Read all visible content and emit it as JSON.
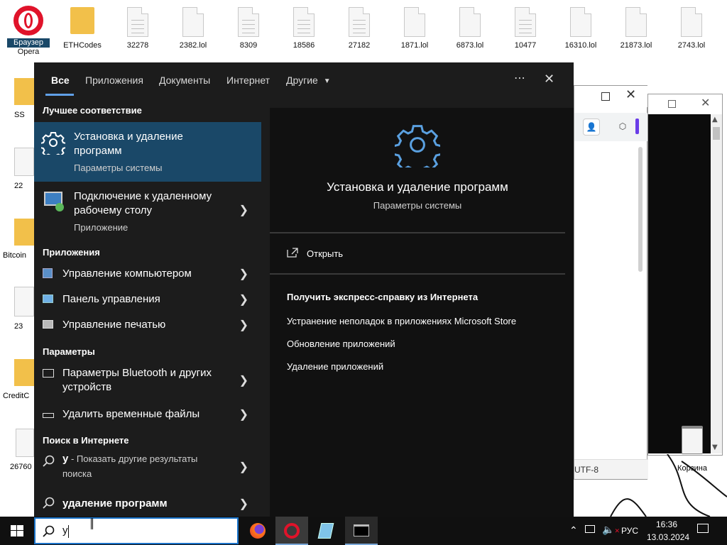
{
  "desktop": {
    "top_icons": [
      {
        "label": "Браузер",
        "label2": "Opera",
        "type": "opera"
      },
      {
        "label": "ETHCodes",
        "type": "folder"
      },
      {
        "label": "32278",
        "type": "lines"
      },
      {
        "label": "2382.lol",
        "type": "file"
      },
      {
        "label": "8309",
        "type": "lines"
      },
      {
        "label": "18586",
        "type": "lines"
      },
      {
        "label": "27182",
        "type": "lines"
      },
      {
        "label": "1871.lol",
        "type": "file"
      },
      {
        "label": "6873.lol",
        "type": "file"
      },
      {
        "label": "10477",
        "type": "lines"
      },
      {
        "label": "16310.lol",
        "type": "file"
      },
      {
        "label": "21873.lol",
        "type": "file"
      },
      {
        "label": "2743.lol",
        "type": "file"
      }
    ],
    "left_icons": [
      "SS",
      "22",
      "Bitcoin",
      "23",
      "CreditC",
      "26760"
    ],
    "right_icons": {
      "recycle": "Корзина"
    },
    "bgwindow": {
      "encoding": "UTF-8"
    }
  },
  "start_menu": {
    "tabs": [
      "Все",
      "Приложения",
      "Документы",
      "Интернет",
      "Другие"
    ],
    "more_icon": "ellipsis-icon",
    "close_icon": "close-icon",
    "sections": {
      "best_match": "Лучшее соответствие",
      "apps": "Приложения",
      "settings": "Параметры",
      "web": "Поиск в Интернете"
    },
    "best_match": {
      "title_line1": "Установка и удаление",
      "title_line2": "программ",
      "subtitle": "Параметры системы"
    },
    "remote_desktop": {
      "title_line1": "Подключение к удаленному",
      "title_line2": "рабочему столу",
      "subtitle": "Приложение"
    },
    "apps": [
      {
        "label": "Управление компьютером",
        "icon": "computer-management-icon"
      },
      {
        "label": "Панель управления",
        "icon": "control-panel-icon"
      },
      {
        "label": "Управление печатью",
        "icon": "print-management-icon"
      }
    ],
    "settings": [
      {
        "label1": "Параметры Bluetooth и других",
        "label2": "устройств",
        "icon": "bluetooth-devices-icon"
      },
      {
        "label1": "Удалить временные файлы",
        "label2": "",
        "icon": "storage-icon"
      }
    ],
    "web": [
      {
        "query": "у",
        "rest": " - Показать другие результаты",
        "rest2": "поиска"
      },
      {
        "query": "удаление программ"
      }
    ],
    "preview": {
      "title": "Установка и удаление программ",
      "subtitle": "Параметры системы",
      "open_label": "Открыть",
      "help_heading": "Получить экспресс-справку из Интернета",
      "help_links": [
        "Устранение неполадок в приложениях Microsoft Store",
        "Обновление приложений",
        "Удаление приложений"
      ]
    }
  },
  "taskbar": {
    "search_value": "у",
    "language": "РУС",
    "time": "16:36",
    "date": "13.03.2024"
  },
  "colors": {
    "accent": "#1a4868",
    "taskbar": "#101010",
    "menu": "#1c1c1c"
  }
}
